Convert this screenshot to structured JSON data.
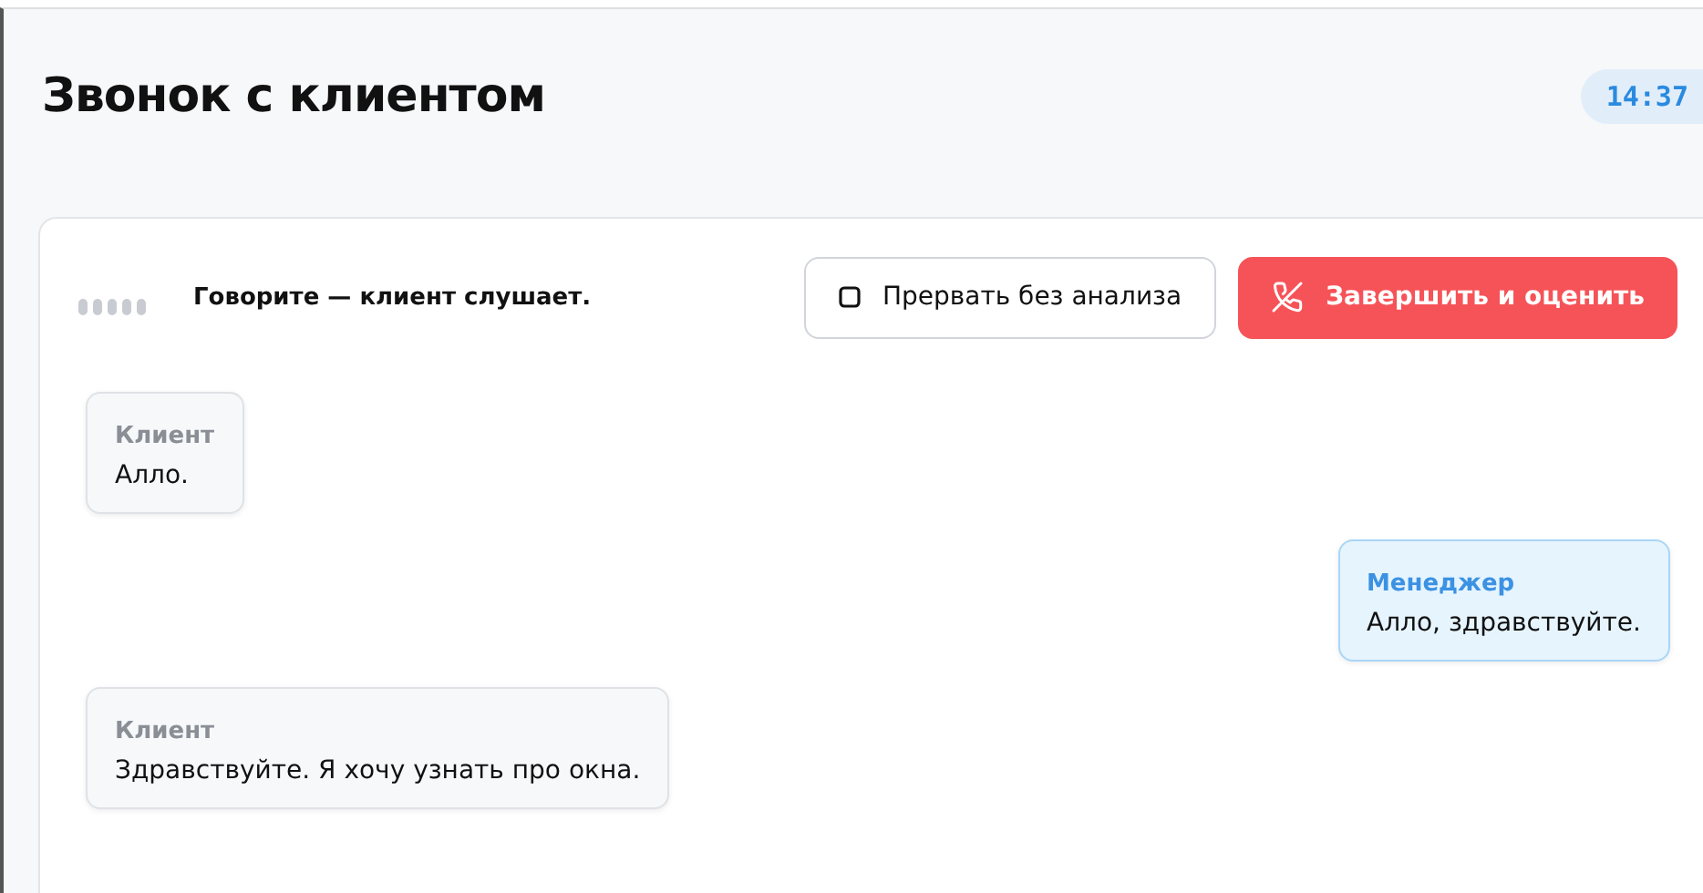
{
  "header": {
    "title": "Звонок с клиентом",
    "timer": "14:37"
  },
  "status": {
    "text": "Говорите — клиент слушает."
  },
  "buttons": [
    {
      "kind": "secondary",
      "label": "Прервать без анализа"
    },
    {
      "kind": "danger",
      "label": "Завершить и оценить"
    }
  ],
  "messages": [
    {
      "kind": "client",
      "author": "Клиент",
      "text": "Алло."
    },
    {
      "kind": "manager",
      "author": "Менеджер",
      "text": "Алло, здравствуйте."
    },
    {
      "kind": "client",
      "author": "Клиент",
      "text": "Здравствуйте. Я хочу узнать про окна."
    }
  ]
}
